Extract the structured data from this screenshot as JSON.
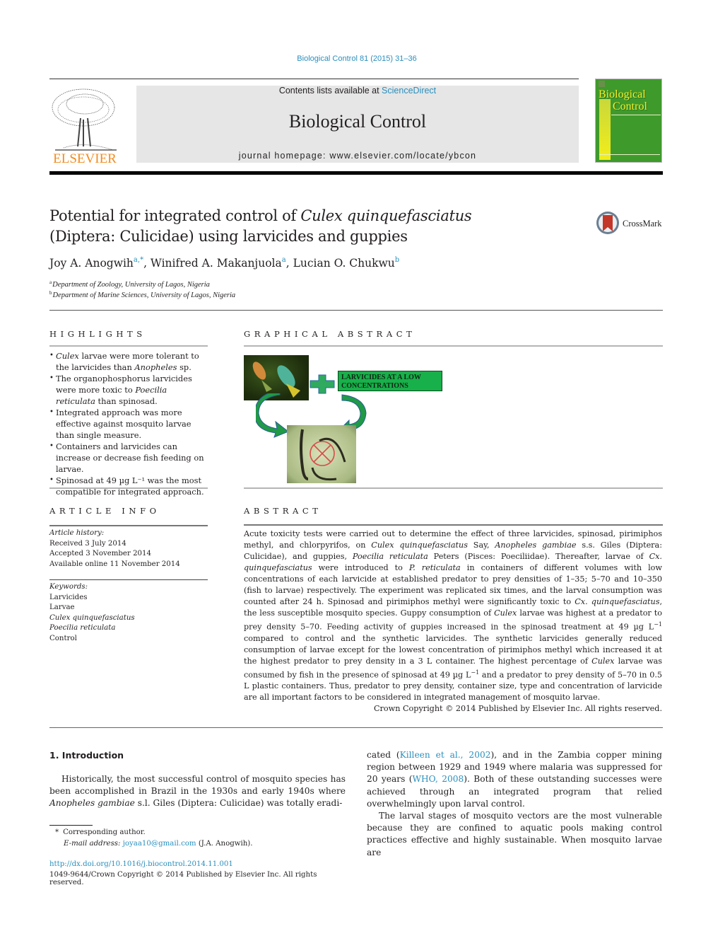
{
  "header": {
    "citation": "Biological Control 81 (2015) 31–36",
    "contents_prefix": "Contents lists available at ",
    "contents_link": "ScienceDirect",
    "journal_title": "Biological Control",
    "homepage": "journal homepage: www.elsevier.com/locate/ybcon",
    "publisher_logo_text": "ELSEVIER",
    "cover_title_line1": "Biological",
    "cover_title_line2": "Control",
    "crossmark_label": "CrossMark"
  },
  "article": {
    "title_part1": "Potential for integrated control of ",
    "title_italic": "Culex quinquefasciatus",
    "title_part2": "(Diptera: Culicidae) using larvicides and guppies",
    "authors": [
      {
        "name": "Joy A. Anogwih",
        "sup": "a,*"
      },
      {
        "name": "Winifred A. Makanjuola",
        "sup": "a"
      },
      {
        "name": "Lucian O. Chukwu",
        "sup": "b"
      }
    ],
    "affiliations": [
      {
        "sup": "a",
        "text": "Department of Zoology, University of Lagos, Nigeria"
      },
      {
        "sup": "b",
        "text": "Department of Marine Sciences, University of Lagos, Nigeria"
      }
    ]
  },
  "highlights": {
    "heading": "HIGHLIGHTS",
    "items": [
      {
        "i": "Culex",
        "t": " larvae were more tolerant to the larvicides than ",
        "i2": "Anopheles",
        "t2": " sp."
      },
      {
        "t": "The organophosphorus larvicides were more toxic to ",
        "i2": "Poecilia reticulata",
        "t2": " than spinosad."
      },
      {
        "t": "Integrated approach was more effective against mosquito larvae than single measure."
      },
      {
        "t": "Containers and larvicides can increase or decrease fish feeding on larvae."
      },
      {
        "t": "Spinosad at 49 µg L⁻¹ was the most compatible for integrated approach."
      }
    ]
  },
  "graphical_abstract": {
    "heading": "GRAPHICAL ABSTRACT",
    "box_text_line1": "LARVICIDES AT A LOW",
    "box_text_line2": "CONCENTRATIONS",
    "colors": {
      "green": "#18b04a",
      "arrow": "#1f9a45",
      "cross": "#d94a4a"
    }
  },
  "article_info": {
    "heading": "ARTICLE INFO",
    "history_label": "Article history:",
    "history": [
      "Received 3 July 2014",
      "Accepted 3 November 2014",
      "Available online 11 November 2014"
    ],
    "keywords_label": "Keywords:",
    "keywords": [
      {
        "text": "Larvicides",
        "italic": false
      },
      {
        "text": "Larvae",
        "italic": false
      },
      {
        "text": "Culex quinquefasciatus",
        "italic": true
      },
      {
        "text": "Poecilia reticulata",
        "italic": true
      },
      {
        "text": "Control",
        "italic": false
      }
    ]
  },
  "abstract": {
    "heading": "ABSTRACT",
    "copyright": "Crown Copyright © 2014 Published by Elsevier Inc. All rights reserved."
  },
  "intro": {
    "heading": "1. Introduction",
    "cite1": "Killeen et al., 2002",
    "cite2": "WHO, 2008"
  },
  "footnotes": {
    "corresponding": "Corresponding author.",
    "email_label": "E-mail address:",
    "email": "joyaa10@gmail.com",
    "email_suffix": " (J.A. Anogwih).",
    "doi": "http://dx.doi.org/10.1016/j.biocontrol.2014.11.001",
    "issn_line": "1049-9644/Crown Copyright © 2014 Published by Elsevier Inc. All rights reserved."
  }
}
